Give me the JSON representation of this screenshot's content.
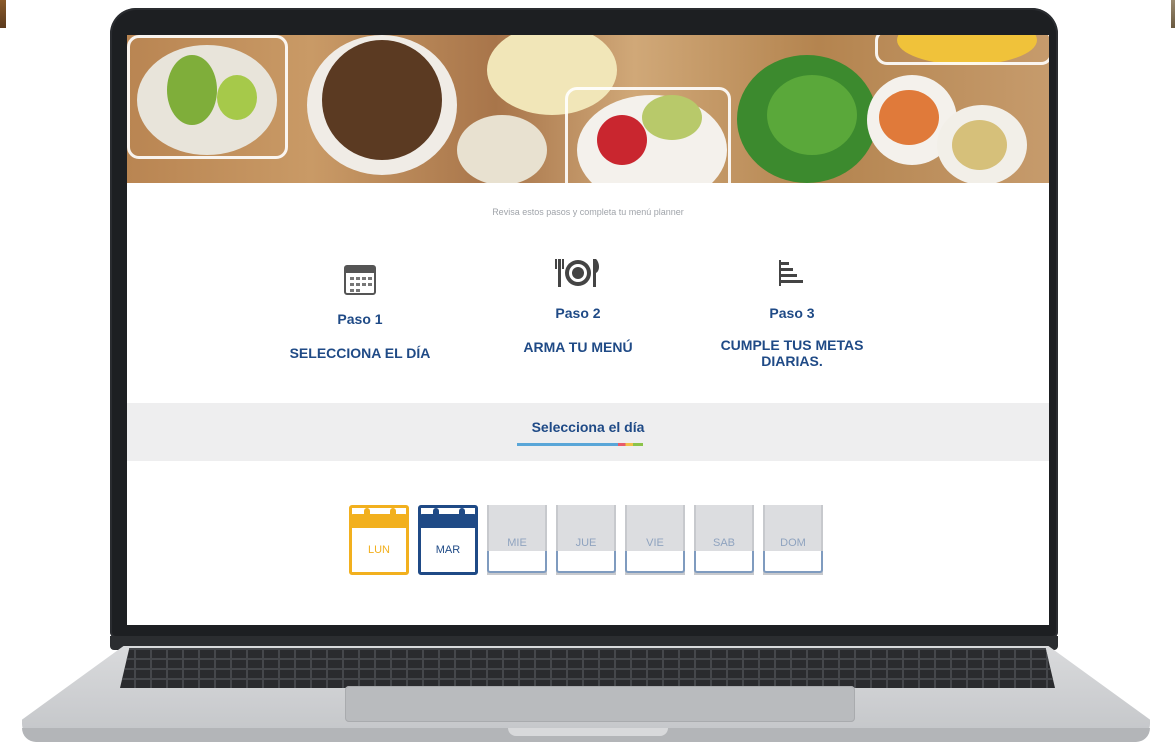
{
  "subtitle": "Revisa estos pasos y completa tu menú planner",
  "steps": [
    {
      "icon": "calendar-icon",
      "number": "Paso 1",
      "text": "SELECCIONA EL DÍA"
    },
    {
      "icon": "plate-cutlery-icon",
      "number": "Paso 2",
      "text": "ARMA TU MENÚ"
    },
    {
      "icon": "bar-list-icon",
      "number": "Paso 3",
      "text": "CUMPLE TUS METAS DIARIAS."
    }
  ],
  "section": {
    "title": "Selecciona el día"
  },
  "days": [
    {
      "label": "LUN",
      "state": "selected",
      "color": "#f2b01e"
    },
    {
      "label": "MAR",
      "state": "current",
      "color": "#1f4a86"
    },
    {
      "label": "MIE",
      "state": "inactive"
    },
    {
      "label": "JUE",
      "state": "inactive"
    },
    {
      "label": "VIE",
      "state": "inactive"
    },
    {
      "label": "SAB",
      "state": "inactive"
    },
    {
      "label": "DOM",
      "state": "inactive"
    }
  ],
  "colors": {
    "brand_blue": "#1f4a86",
    "accent_yellow": "#f2b01e",
    "band_bg": "#eeeeef"
  }
}
